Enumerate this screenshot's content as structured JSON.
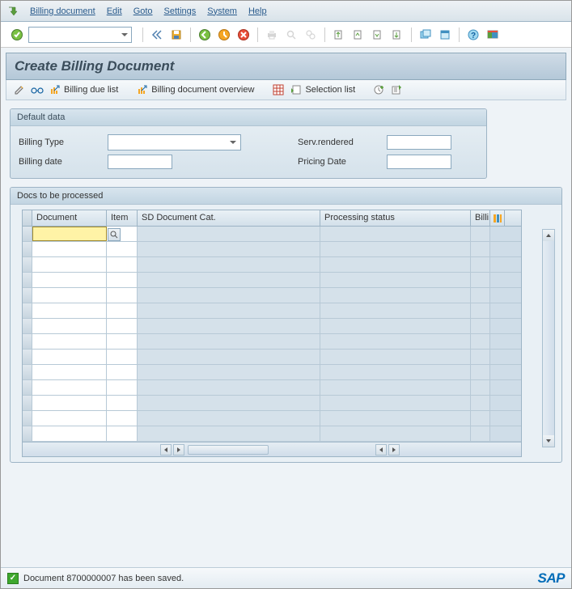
{
  "menu": {
    "items": [
      "Billing document",
      "Edit",
      "Goto",
      "Settings",
      "System",
      "Help"
    ]
  },
  "title": "Create Billing Document",
  "app_toolbar": {
    "billing_due_list": "Billing due list",
    "billing_doc_overview": "Billing document overview",
    "selection_list": "Selection list"
  },
  "default_data": {
    "group_title": "Default data",
    "billing_type_label": "Billing Type",
    "billing_type_value": "",
    "billing_date_label": "Billing date",
    "billing_date_value": "",
    "serv_rendered_label": "Serv.rendered",
    "serv_rendered_value": "",
    "pricing_date_label": "Pricing Date",
    "pricing_date_value": ""
  },
  "docs": {
    "group_title": "Docs to be processed",
    "columns": {
      "document": "Document",
      "item": "Item",
      "sd_doc_cat": "SD Document Cat.",
      "processing_status": "Processing status",
      "billing": "Billi"
    },
    "rows": [
      {
        "document": "",
        "item": "",
        "sd_cat": "",
        "status": ""
      },
      {
        "document": "",
        "item": "",
        "sd_cat": "",
        "status": ""
      },
      {
        "document": "",
        "item": "",
        "sd_cat": "",
        "status": ""
      },
      {
        "document": "",
        "item": "",
        "sd_cat": "",
        "status": ""
      },
      {
        "document": "",
        "item": "",
        "sd_cat": "",
        "status": ""
      },
      {
        "document": "",
        "item": "",
        "sd_cat": "",
        "status": ""
      },
      {
        "document": "",
        "item": "",
        "sd_cat": "",
        "status": ""
      },
      {
        "document": "",
        "item": "",
        "sd_cat": "",
        "status": ""
      },
      {
        "document": "",
        "item": "",
        "sd_cat": "",
        "status": ""
      },
      {
        "document": "",
        "item": "",
        "sd_cat": "",
        "status": ""
      },
      {
        "document": "",
        "item": "",
        "sd_cat": "",
        "status": ""
      },
      {
        "document": "",
        "item": "",
        "sd_cat": "",
        "status": ""
      },
      {
        "document": "",
        "item": "",
        "sd_cat": "",
        "status": ""
      },
      {
        "document": "",
        "item": "",
        "sd_cat": "",
        "status": ""
      }
    ]
  },
  "status_message": "Document 8700000007 has been saved.",
  "logo": "SAP"
}
